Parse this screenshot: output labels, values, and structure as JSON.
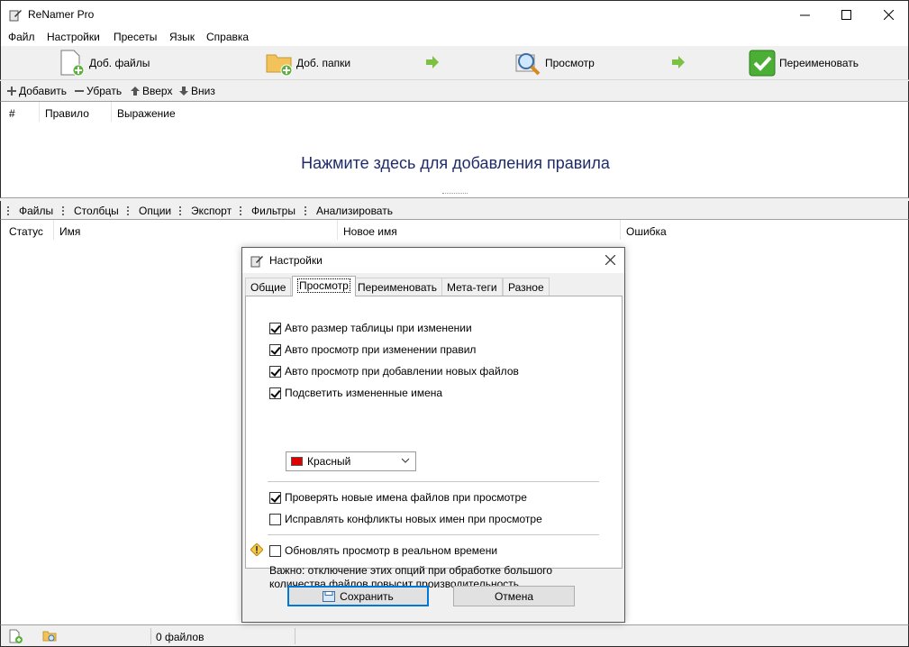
{
  "window": {
    "title": "ReNamer Pro"
  },
  "menu": [
    "Файл",
    "Настройки",
    "Пресеты",
    "Язык",
    "Справка"
  ],
  "main_toolbar": {
    "add_files": "Доб. файлы",
    "add_folders": "Доб. папки",
    "preview": "Просмотр",
    "rename": "Переименовать"
  },
  "rules_toolbar": {
    "add": "Добавить",
    "remove": "Убрать",
    "up": "Вверх",
    "down": "Вниз"
  },
  "rules_table": {
    "columns": [
      "#",
      "Правило",
      "Выражение"
    ],
    "hint": "Нажмите здесь для добавления правила"
  },
  "files_toolbar": [
    "Файлы",
    "Столбцы",
    "Опции",
    "Экспорт",
    "Фильтры",
    "Анализировать"
  ],
  "files_table": {
    "columns": [
      "Статус",
      "Имя",
      "Новое имя",
      "Ошибка"
    ]
  },
  "status_bar": {
    "count": "0 файлов"
  },
  "dialog": {
    "title": "Настройки",
    "tabs": [
      "Общие",
      "Просмотр",
      "Переименовать",
      "Мета-теги",
      "Разное"
    ],
    "active_tab": "Просмотр",
    "options": [
      {
        "label": "Авто размер таблицы при изменении",
        "checked": true
      },
      {
        "label": "Авто просмотр при изменении правил",
        "checked": true
      },
      {
        "label": "Авто просмотр при добавлении новых файлов",
        "checked": true
      },
      {
        "label": "Подсветить измененные имена",
        "checked": true
      }
    ],
    "highlight_color": {
      "label": "Красный",
      "color": "#e00000"
    },
    "options2": [
      {
        "label": "Проверять новые имена файлов при просмотре",
        "checked": true
      },
      {
        "label": "Исправлять конфликты новых имен при просмотре",
        "checked": false
      }
    ],
    "realtime": {
      "label": "Обновлять просмотр в реальном времени",
      "checked": false
    },
    "note": "Важно: отключение этих опций при обработке большого количества файлов повысит производительность.",
    "save_label": "Сохранить",
    "cancel_label": "Отмена"
  }
}
